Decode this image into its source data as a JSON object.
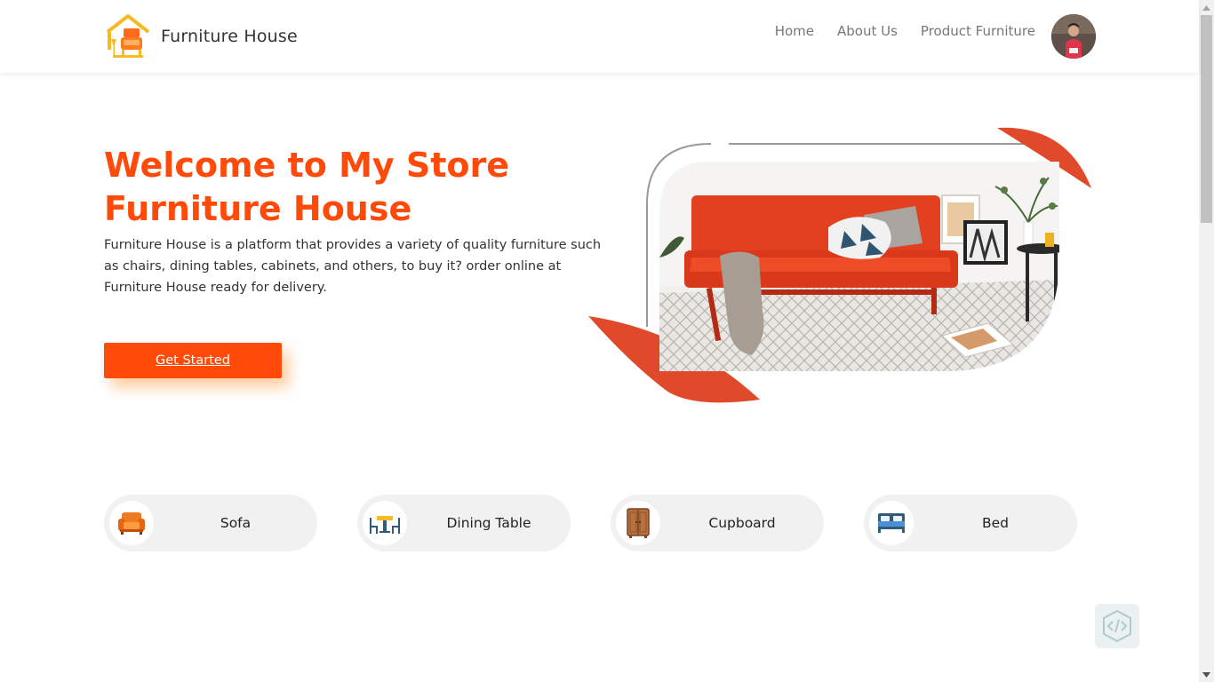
{
  "brand": {
    "name": "Furniture House"
  },
  "nav": {
    "links": [
      {
        "label": "Home"
      },
      {
        "label": "About Us"
      },
      {
        "label": "Product Furniture"
      }
    ]
  },
  "hero": {
    "title_line1": "Welcome to My Store",
    "title_line2": "Furniture House",
    "description": "Furniture House is a platform that provides a variety of quality furniture such as chairs, dining tables, cabinets, and others, to buy it? order online at Furniture House ready for delivery.",
    "cta_label": "Get Started"
  },
  "categories": [
    {
      "label": "Sofa",
      "icon": "sofa-icon"
    },
    {
      "label": "Dining Table",
      "icon": "dining-table-icon"
    },
    {
      "label": "Cupboard",
      "icon": "cupboard-icon"
    },
    {
      "label": "Bed",
      "icon": "bed-icon"
    }
  ],
  "colors": {
    "accent": "#ff4a0a",
    "swoosh": "#e0492a",
    "category_bg": "#f1f1f1"
  }
}
